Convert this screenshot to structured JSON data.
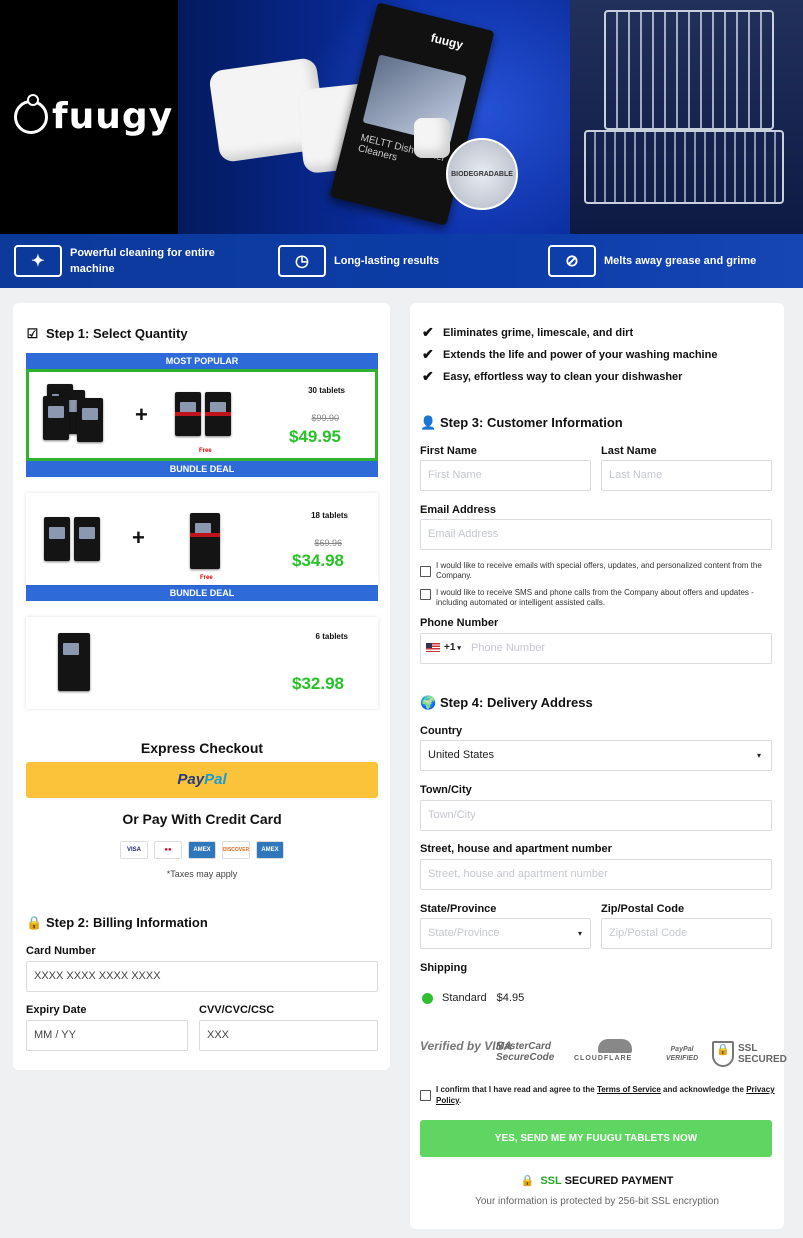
{
  "brand": "fuugy",
  "hero": {
    "pack_brand": "fuugy",
    "pack_text": "MELTT Dishwasher Cleaners",
    "seal": "BIODEGRADABLE"
  },
  "features": [
    {
      "icon": "dishwasher-sparkle-icon",
      "text": "Powerful cleaning for entire machine"
    },
    {
      "icon": "dishwasher-clock-icon",
      "text": "Long-lasting results"
    },
    {
      "icon": "dishwasher-no-grease-icon",
      "text": "Melts away grease and grime"
    }
  ],
  "step1": {
    "title": "Step 1: Select Quantity",
    "offers": [
      {
        "top_ribbon": "MOST POPULAR",
        "bottom_ribbon": "BUNDLE DEAL",
        "tablets": "30 tablets",
        "old_price": "$99.90",
        "price": "$49.95",
        "free": "Free",
        "selected": true
      },
      {
        "top_ribbon": "",
        "bottom_ribbon": "BUNDLE DEAL",
        "tablets": "18 tablets",
        "old_price": "$69.96",
        "price": "$34.98",
        "free": "Free",
        "selected": false
      },
      {
        "top_ribbon": "",
        "bottom_ribbon": "",
        "tablets": "6 tablets",
        "old_price": "",
        "price": "$32.98",
        "free": "",
        "selected": false
      }
    ]
  },
  "checkout": {
    "express": "Express Checkout",
    "paypal_a": "Pay",
    "paypal_b": "Pal",
    "or_card": "Or Pay With Credit Card",
    "cards": [
      "VISA",
      "MC",
      "AMEX",
      "DISCOVER",
      "AMEX"
    ],
    "taxes": "*Taxes may apply"
  },
  "step2": {
    "title": "Step 2: Billing Information",
    "card_number_label": "Card Number",
    "card_number_placeholder": "XXXX XXXX XXXX XXXX",
    "expiry_label": "Expiry Date",
    "expiry_placeholder": "MM / YY",
    "cvv_label": "CVV/CVC/CSC",
    "cvv_placeholder": "XXX"
  },
  "benefits": [
    "Eliminates grime, limescale, and dirt",
    "Extends the life and power of your washing machine",
    "Easy, effortless way to clean your dishwasher"
  ],
  "step3": {
    "title": "Step 3: Customer Information",
    "first_name_label": "First Name",
    "first_name_placeholder": "First Name",
    "last_name_label": "Last Name",
    "last_name_placeholder": "Last Name",
    "email_label": "Email Address",
    "email_placeholder": "Email Address",
    "consent_email": "I would like to receive emails with special offers, updates, and personalized content from the Company.",
    "consent_sms": "I would like to receive SMS and phone calls from the Company about offers and updates - including automated or intelligent assisted calls.",
    "phone_label": "Phone Number",
    "phone_code": "+1",
    "phone_placeholder": "Phone Number"
  },
  "step4": {
    "title": "Step 4: Delivery Address",
    "country_label": "Country",
    "country_value": "United States",
    "town_label": "Town/City",
    "town_placeholder": "Town/City",
    "street_label": "Street, house and apartment number",
    "street_placeholder": "Street, house and apartment number",
    "state_label": "State/Province",
    "state_placeholder": "State/Province",
    "zip_label": "Zip/Postal Code",
    "zip_placeholder": "Zip/Postal Code",
    "shipping_label": "Shipping",
    "shipping_option": "Standard",
    "shipping_price": "$4.95"
  },
  "trust_badges": [
    "Verified by VISA",
    "MasterCard SecureCode",
    "CLOUDFLARE",
    "PayPal VERIFIED",
    "SSL SECURED"
  ],
  "agree": {
    "pre": "I confirm that I have read and agree to the ",
    "terms": "Terms of Service",
    "mid": " and acknowledge the ",
    "privacy": "Privacy Policy",
    "post": "."
  },
  "submit_label": "YES, SEND ME MY FUUGU TABLETS NOW",
  "ssl": {
    "badge_a": "SSL",
    "badge_b": " SECURED PAYMENT",
    "note": "Your information is protected by 256-bit SSL encryption"
  },
  "colors": {
    "accent_green": "#27c227",
    "ribbon_blue": "#2f6bd8",
    "paypal_yellow": "#fbc33a",
    "submit_green": "#5fd661"
  }
}
